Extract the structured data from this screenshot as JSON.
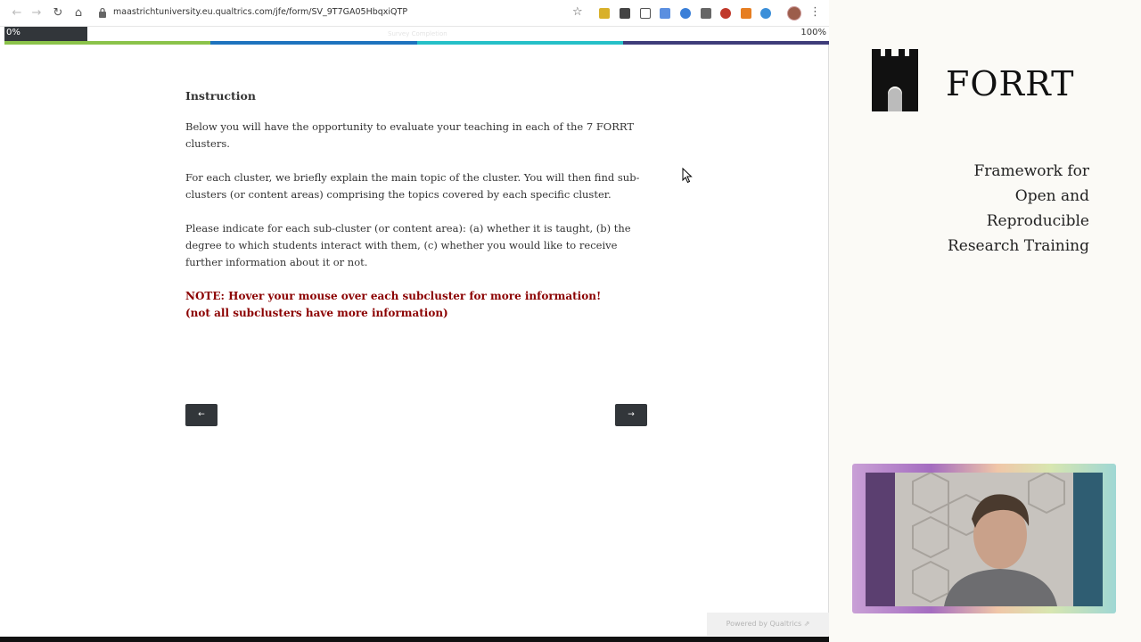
{
  "browser": {
    "url": "maastrichtuniversity.eu.qualtrics.com/jfe/form/SV_9T7GA05HbqxiQTP"
  },
  "progress": {
    "start_label": "0%",
    "end_label": "100%",
    "caption": "Survey Completion",
    "value": 0.1,
    "stripe_colors": [
      "#8bc34a",
      "#1e73be",
      "#26c0c8",
      "#3f3d7a"
    ]
  },
  "survey": {
    "heading": "Instruction",
    "paragraphs": [
      "Below you will have the opportunity to evaluate your teaching in each of the 7 FORRT clusters.",
      "For each cluster, we briefly explain the main topic of the cluster. You will then find sub-clusters (or content areas) comprising the topics covered by each specific cluster.",
      "Please indicate for each sub-cluster (or content area): (a) whether it is taught, (b) the degree to which students interact with them, (c) whether you would like to receive further information about it or not."
    ],
    "note_line1": "NOTE: Hover your mouse over each subcluster for more information!",
    "note_line2": "(not all subclusters have more information)",
    "prev_label": "←",
    "next_label": "→",
    "powered_by": "Powered by Qualtrics ⇗",
    "note_color": "#8b0000"
  },
  "forrt": {
    "title": "FORRT",
    "tagline": [
      "Framework for",
      "Open and",
      "Reproducible",
      "Research Training"
    ]
  },
  "icons": [
    "back-arrow-icon",
    "forward-arrow-icon",
    "reload-icon",
    "home-icon",
    "lock-icon",
    "star-icon",
    "menu-icon",
    "castle-icon",
    "mouse-cursor-icon"
  ]
}
